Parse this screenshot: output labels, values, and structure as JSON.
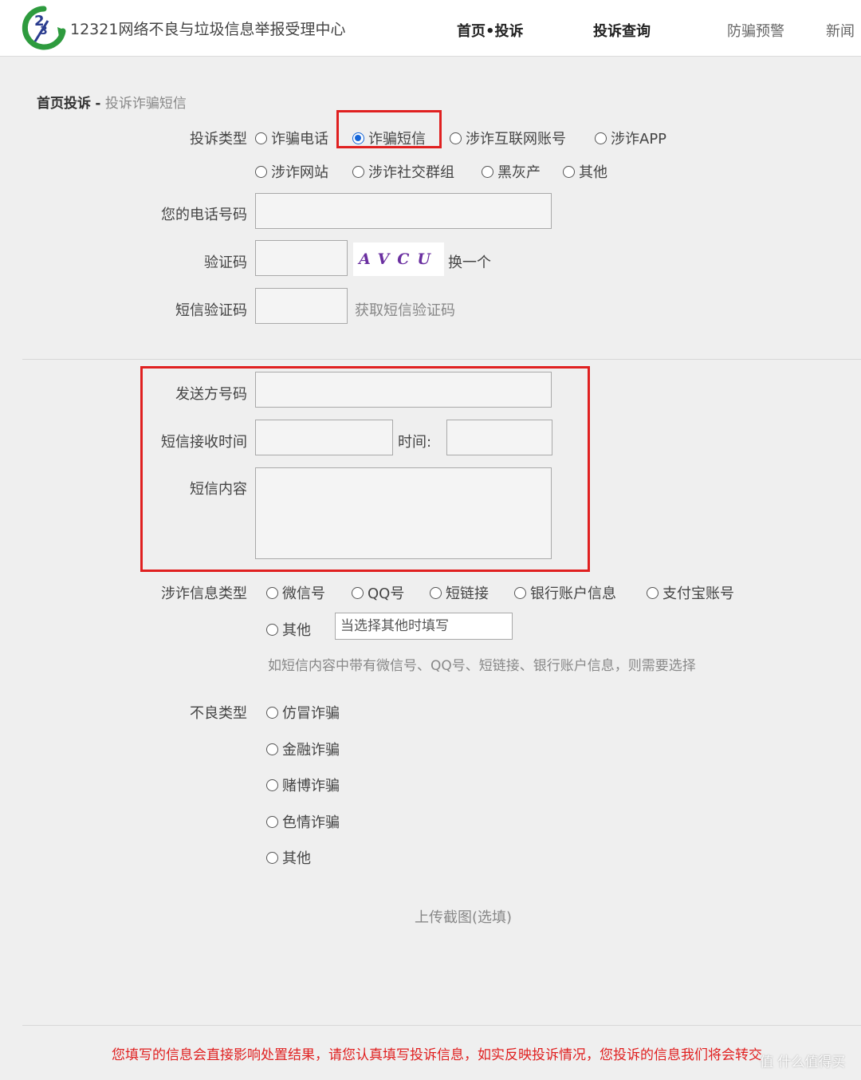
{
  "header": {
    "site_title": "12321网络不良与垃圾信息举报受理中心",
    "nav": [
      "首页•投诉",
      "投诉查询",
      "防骗预警",
      "新闻"
    ]
  },
  "breadcrumb": {
    "home": "首页投诉",
    "separator": "-",
    "current": "投诉诈骗短信"
  },
  "complaint_type": {
    "label": "投诉类型",
    "options": [
      "诈骗电话",
      "诈骗短信",
      "涉诈互联网账号",
      "涉诈APP",
      "涉诈网站",
      "涉诈社交群组",
      "黑灰产",
      "其他"
    ],
    "selected": "诈骗短信"
  },
  "phone": {
    "label": "您的电话号码",
    "value": ""
  },
  "captcha": {
    "label": "验证码",
    "image_text": "AVCU",
    "refresh": "换一个"
  },
  "sms_code": {
    "label": "短信验证码",
    "get_code": "获取短信验证码"
  },
  "sender": {
    "label": "发送方号码"
  },
  "receive_time": {
    "label": "短信接收时间",
    "time_label": "时间:"
  },
  "content": {
    "label": "短信内容"
  },
  "fraud_info": {
    "label": "涉诈信息类型",
    "options": [
      "微信号",
      "QQ号",
      "短链接",
      "银行账户信息",
      "支付宝账号",
      "其他"
    ],
    "other_placeholder": "当选择其他时填写",
    "hint": "如短信内容中带有微信号、QQ号、短链接、银行账户信息，则需要选择"
  },
  "bad_type": {
    "label": "不良类型",
    "options": [
      "仿冒诈骗",
      "金融诈骗",
      "赌博诈骗",
      "色情诈骗",
      "其他"
    ]
  },
  "upload": {
    "label": "上传截图(选填)"
  },
  "notice": "您填写的信息会直接影响处置结果，请您认真填写投诉信息，如实反映投诉情况，您投诉的信息我们将会转交",
  "watermark": "值 什么值得买",
  "colors": {
    "highlight": "#e02020",
    "radio_selected": "#1565d8",
    "notice": "#e02020"
  }
}
